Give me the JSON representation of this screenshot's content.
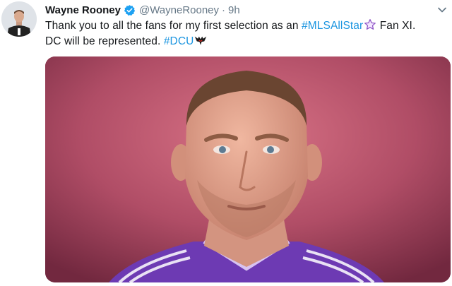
{
  "tweet": {
    "author": {
      "name": "Wayne Rooney",
      "handle": "@WayneRooney"
    },
    "separator": "·",
    "time": "9h",
    "line1_text": "Thank you to all the fans for my first selection as an",
    "hashtag1": "#MLSAllStar",
    "line1_tail": " Fan XI.",
    "line2_text": "DC will be represented.",
    "hashtag2": "#DCU",
    "icons": [
      "verified-badge-icon",
      "star-emoji-icon",
      "dc-united-eagle-icon",
      "chevron-down-icon"
    ],
    "colors": {
      "link": "#1b95e0",
      "secondary_text": "#657786",
      "verified": "#1da1f2",
      "photo_bg": "#b24e66"
    }
  }
}
